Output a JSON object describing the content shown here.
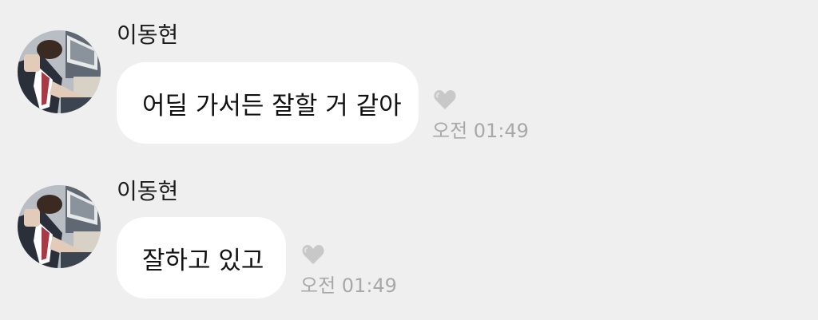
{
  "messages": [
    {
      "sender": "이동현",
      "text": "어딜 가서든 잘할 거 같아",
      "time": "오전 01:49",
      "reaction_icon": "heart-icon"
    },
    {
      "sender": "이동현",
      "text": "잘하고 있고",
      "time": "오전 01:49",
      "reaction_icon": "heart-icon"
    }
  ],
  "colors": {
    "background": "#efefef",
    "bubble": "#ffffff",
    "timestamp": "#a8a8a8",
    "heart": "#c8c8c8"
  }
}
